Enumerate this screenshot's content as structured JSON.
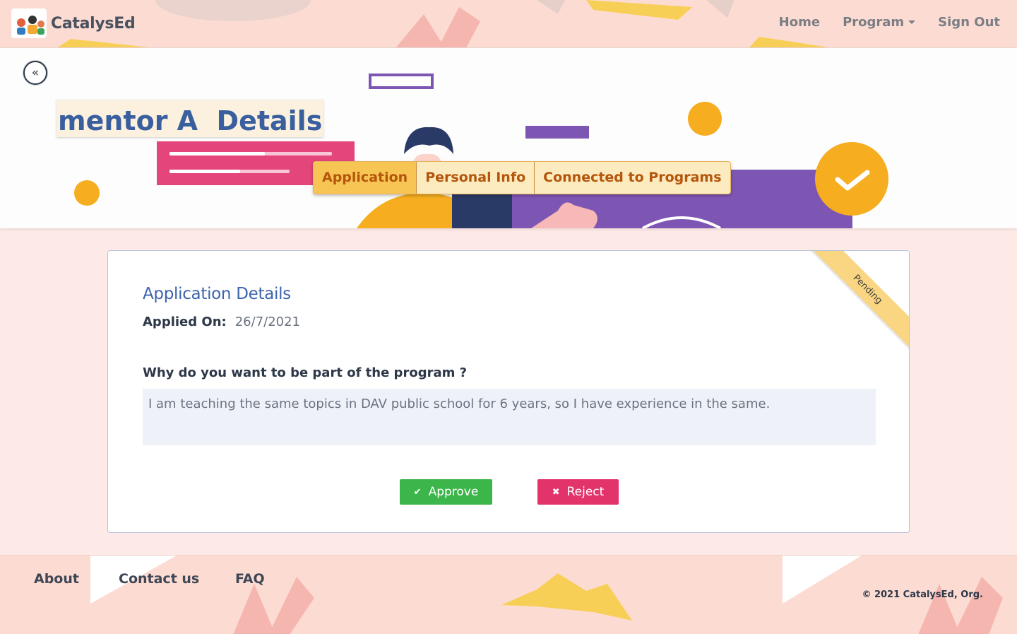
{
  "navbar": {
    "brand_name": "CatalysEd",
    "links": {
      "home": "Home",
      "program": "Program",
      "sign_out": "Sign Out"
    }
  },
  "hero": {
    "back_icon": "«",
    "title": "mentor A  Details",
    "tabs": [
      {
        "label": "Application",
        "active": true
      },
      {
        "label": "Personal Info",
        "active": false
      },
      {
        "label": "Connected to Programs",
        "active": false
      }
    ]
  },
  "card": {
    "status_ribbon": "Pending",
    "section_title": "Application Details",
    "applied_on_label": "Applied On:",
    "applied_on_value": "26/7/2021",
    "question": "Why do you want to be part of the program ?",
    "answer": "I am teaching the same topics in DAV public school for 6 years, so I have experience in the same.",
    "approve_label": "Approve",
    "approve_icon": "✔",
    "reject_label": "Reject",
    "reject_icon": "✖"
  },
  "footer": {
    "about": "About",
    "contact": "Contact us",
    "faq": "FAQ",
    "copyright": "© 2021 CatalysEd, Org."
  },
  "colors": {
    "accent_blue": "#3d64ad",
    "tab_active": "#f7c553",
    "approve": "#3cb54a",
    "reject": "#e3336b",
    "ribbon": "#fbd682"
  }
}
